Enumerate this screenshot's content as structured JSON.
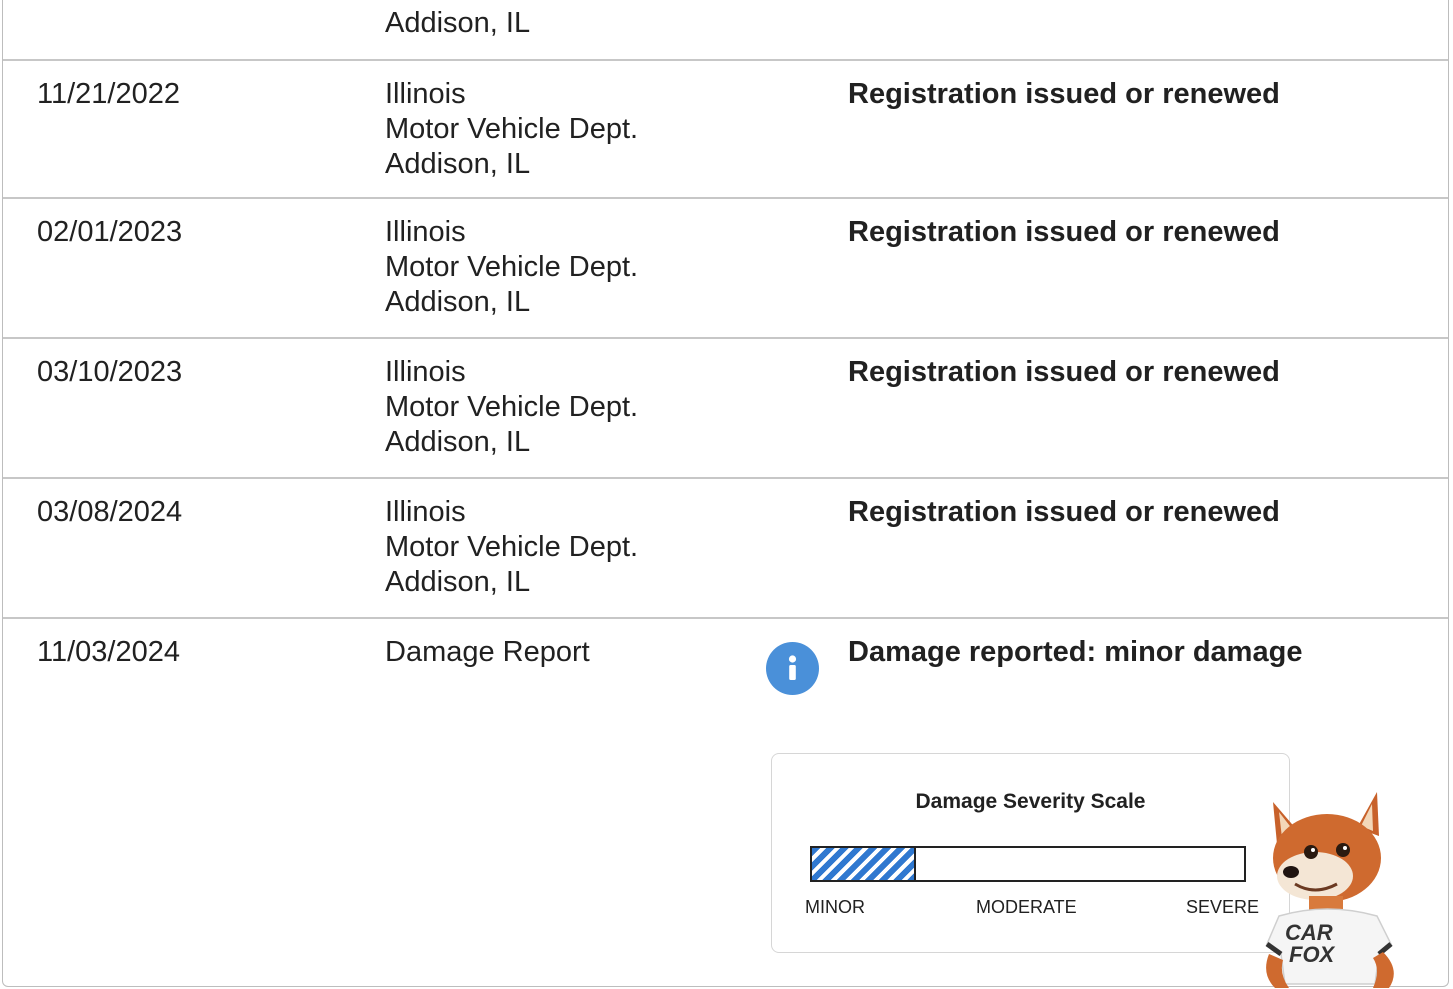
{
  "top_fragment": "Addison, IL",
  "rows": [
    {
      "date": "11/21/2022",
      "source": [
        "Illinois",
        "Motor Vehicle Dept.",
        "Addison, IL"
      ],
      "comment": "Registration issued or renewed"
    },
    {
      "date": "02/01/2023",
      "source": [
        "Illinois",
        "Motor Vehicle Dept.",
        "Addison, IL"
      ],
      "comment": "Registration issued or renewed"
    },
    {
      "date": "03/10/2023",
      "source": [
        "Illinois",
        "Motor Vehicle Dept.",
        "Addison, IL"
      ],
      "comment": "Registration issued or renewed"
    },
    {
      "date": "03/08/2024",
      "source": [
        "Illinois",
        "Motor Vehicle Dept.",
        "Addison, IL"
      ],
      "comment": "Registration issued or renewed"
    },
    {
      "date": "11/03/2024",
      "source": [
        "Damage Report"
      ],
      "comment": "Damage reported: minor damage"
    }
  ],
  "info_icon": {
    "name": "info-icon",
    "glyph": "i",
    "color": "#4a90d9"
  },
  "damage_scale": {
    "title": "Damage Severity Scale",
    "level_fraction": 0.24,
    "labels": {
      "minor": "MINOR",
      "moderate": "MODERATE",
      "severe": "SEVERE"
    },
    "fill_color": "#2f78d0"
  },
  "mascot": {
    "shirt_text": [
      "CAR",
      "FOX"
    ]
  }
}
